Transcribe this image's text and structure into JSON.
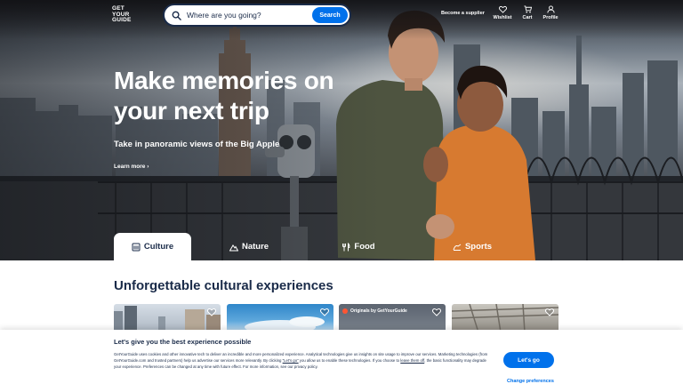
{
  "header": {
    "logo_lines": [
      "GET",
      "YOUR",
      "GUIDE"
    ],
    "search_placeholder": "Where are you going?",
    "search_button": "Search",
    "supplier_link": "Become a supplier",
    "nav": [
      {
        "label": "Wishlist",
        "icon": "heart-icon"
      },
      {
        "label": "Cart",
        "icon": "cart-icon"
      },
      {
        "label": "Profile",
        "icon": "profile-icon"
      }
    ]
  },
  "hero": {
    "headline": "Make memories on your next trip",
    "subline": "Take in panoramic views of the Big Apple",
    "learn_more": "Learn more",
    "learn_more_icon": "chevron-right-icon"
  },
  "tabs": [
    {
      "label": "Culture",
      "icon": "museum-icon",
      "active": true
    },
    {
      "label": "Nature",
      "icon": "mountain-icon",
      "active": false
    },
    {
      "label": "Food",
      "icon": "cutlery-icon",
      "active": false
    },
    {
      "label": "Sports",
      "icon": "sports-icon",
      "active": false
    }
  ],
  "section": {
    "title": "Unforgettable cultural experiences",
    "cards": [
      {
        "badge": ""
      },
      {
        "badge": ""
      },
      {
        "badge": "Originals by GetYourGuide"
      },
      {
        "badge": ""
      }
    ]
  },
  "cookie": {
    "title": "Let's give you the best experience possible",
    "text_1": "GetYourGuide uses cookies and other innovative tech to deliver an incredible and more personalized experience. Analytical technologies give us insights on site usage to improve our services. Marketing technologies (from GetYourGuide.com and trusted partners) help us advertise our services more relevantly. By clicking ",
    "text_link_1": "\"Let's go\"",
    "text_2": " you allow us to enable these technologies. If you choose to ",
    "text_link_2": "leave them off",
    "text_3": ", the basic functionality may degrade your experience. Preferences can be changed at any time with future effect. For more information, see our privacy policy.",
    "accept_button": "Let's go",
    "change_link": "Change preferences"
  },
  "colors": {
    "brand_navy": "#1a2b49",
    "accent_blue": "#0071eb",
    "originals_dot": "#ff5533"
  }
}
